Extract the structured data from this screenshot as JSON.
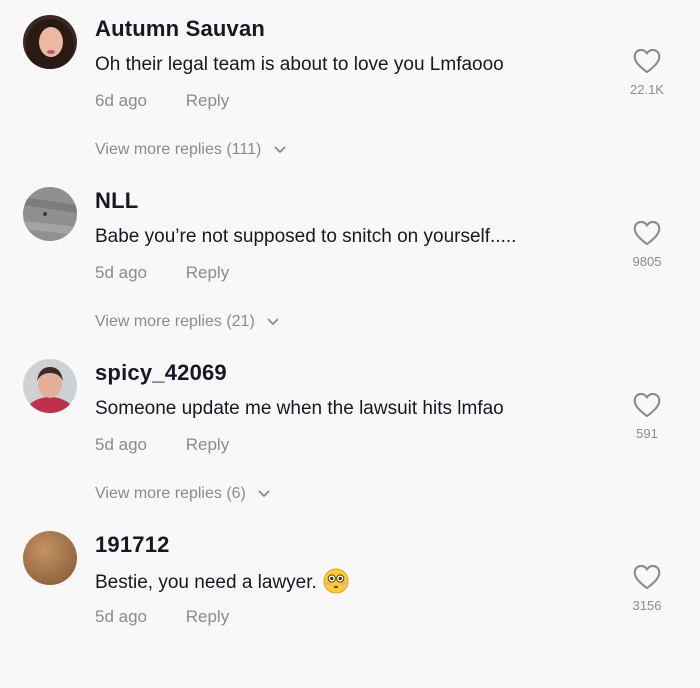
{
  "comments": [
    {
      "username": "Autumn Sauvan",
      "text": "Oh their legal team is about to love you Lmfaooo",
      "time": "6d ago",
      "reply_label": "Reply",
      "likes": "22.1K",
      "more_replies": "View more replies (111)",
      "avatar_icon": "avatar-photo-woman"
    },
    {
      "username": "NLL",
      "text": "Babe you’re not supposed to snitch on yourself.....",
      "time": "5d ago",
      "reply_label": "Reply",
      "likes": "9805",
      "more_replies": "View more replies (21)",
      "avatar_icon": "avatar-photo-gray"
    },
    {
      "username": "spicy_42069",
      "text": "Someone update me when the lawsuit hits lmfao",
      "time": "5d ago",
      "reply_label": "Reply",
      "likes": "591",
      "more_replies": "View more replies (6)",
      "avatar_icon": "avatar-photo-person"
    },
    {
      "username": "191712",
      "text": "Bestie, you need a lawyer.",
      "emoji": "flushed-face-emoji",
      "time": "5d ago",
      "reply_label": "Reply",
      "likes": "3156",
      "avatar_icon": "avatar-photo-brown"
    }
  ],
  "colors": {
    "background": "#f8f8f8",
    "primary_text": "#161823",
    "secondary_text": "#8a8b91"
  }
}
